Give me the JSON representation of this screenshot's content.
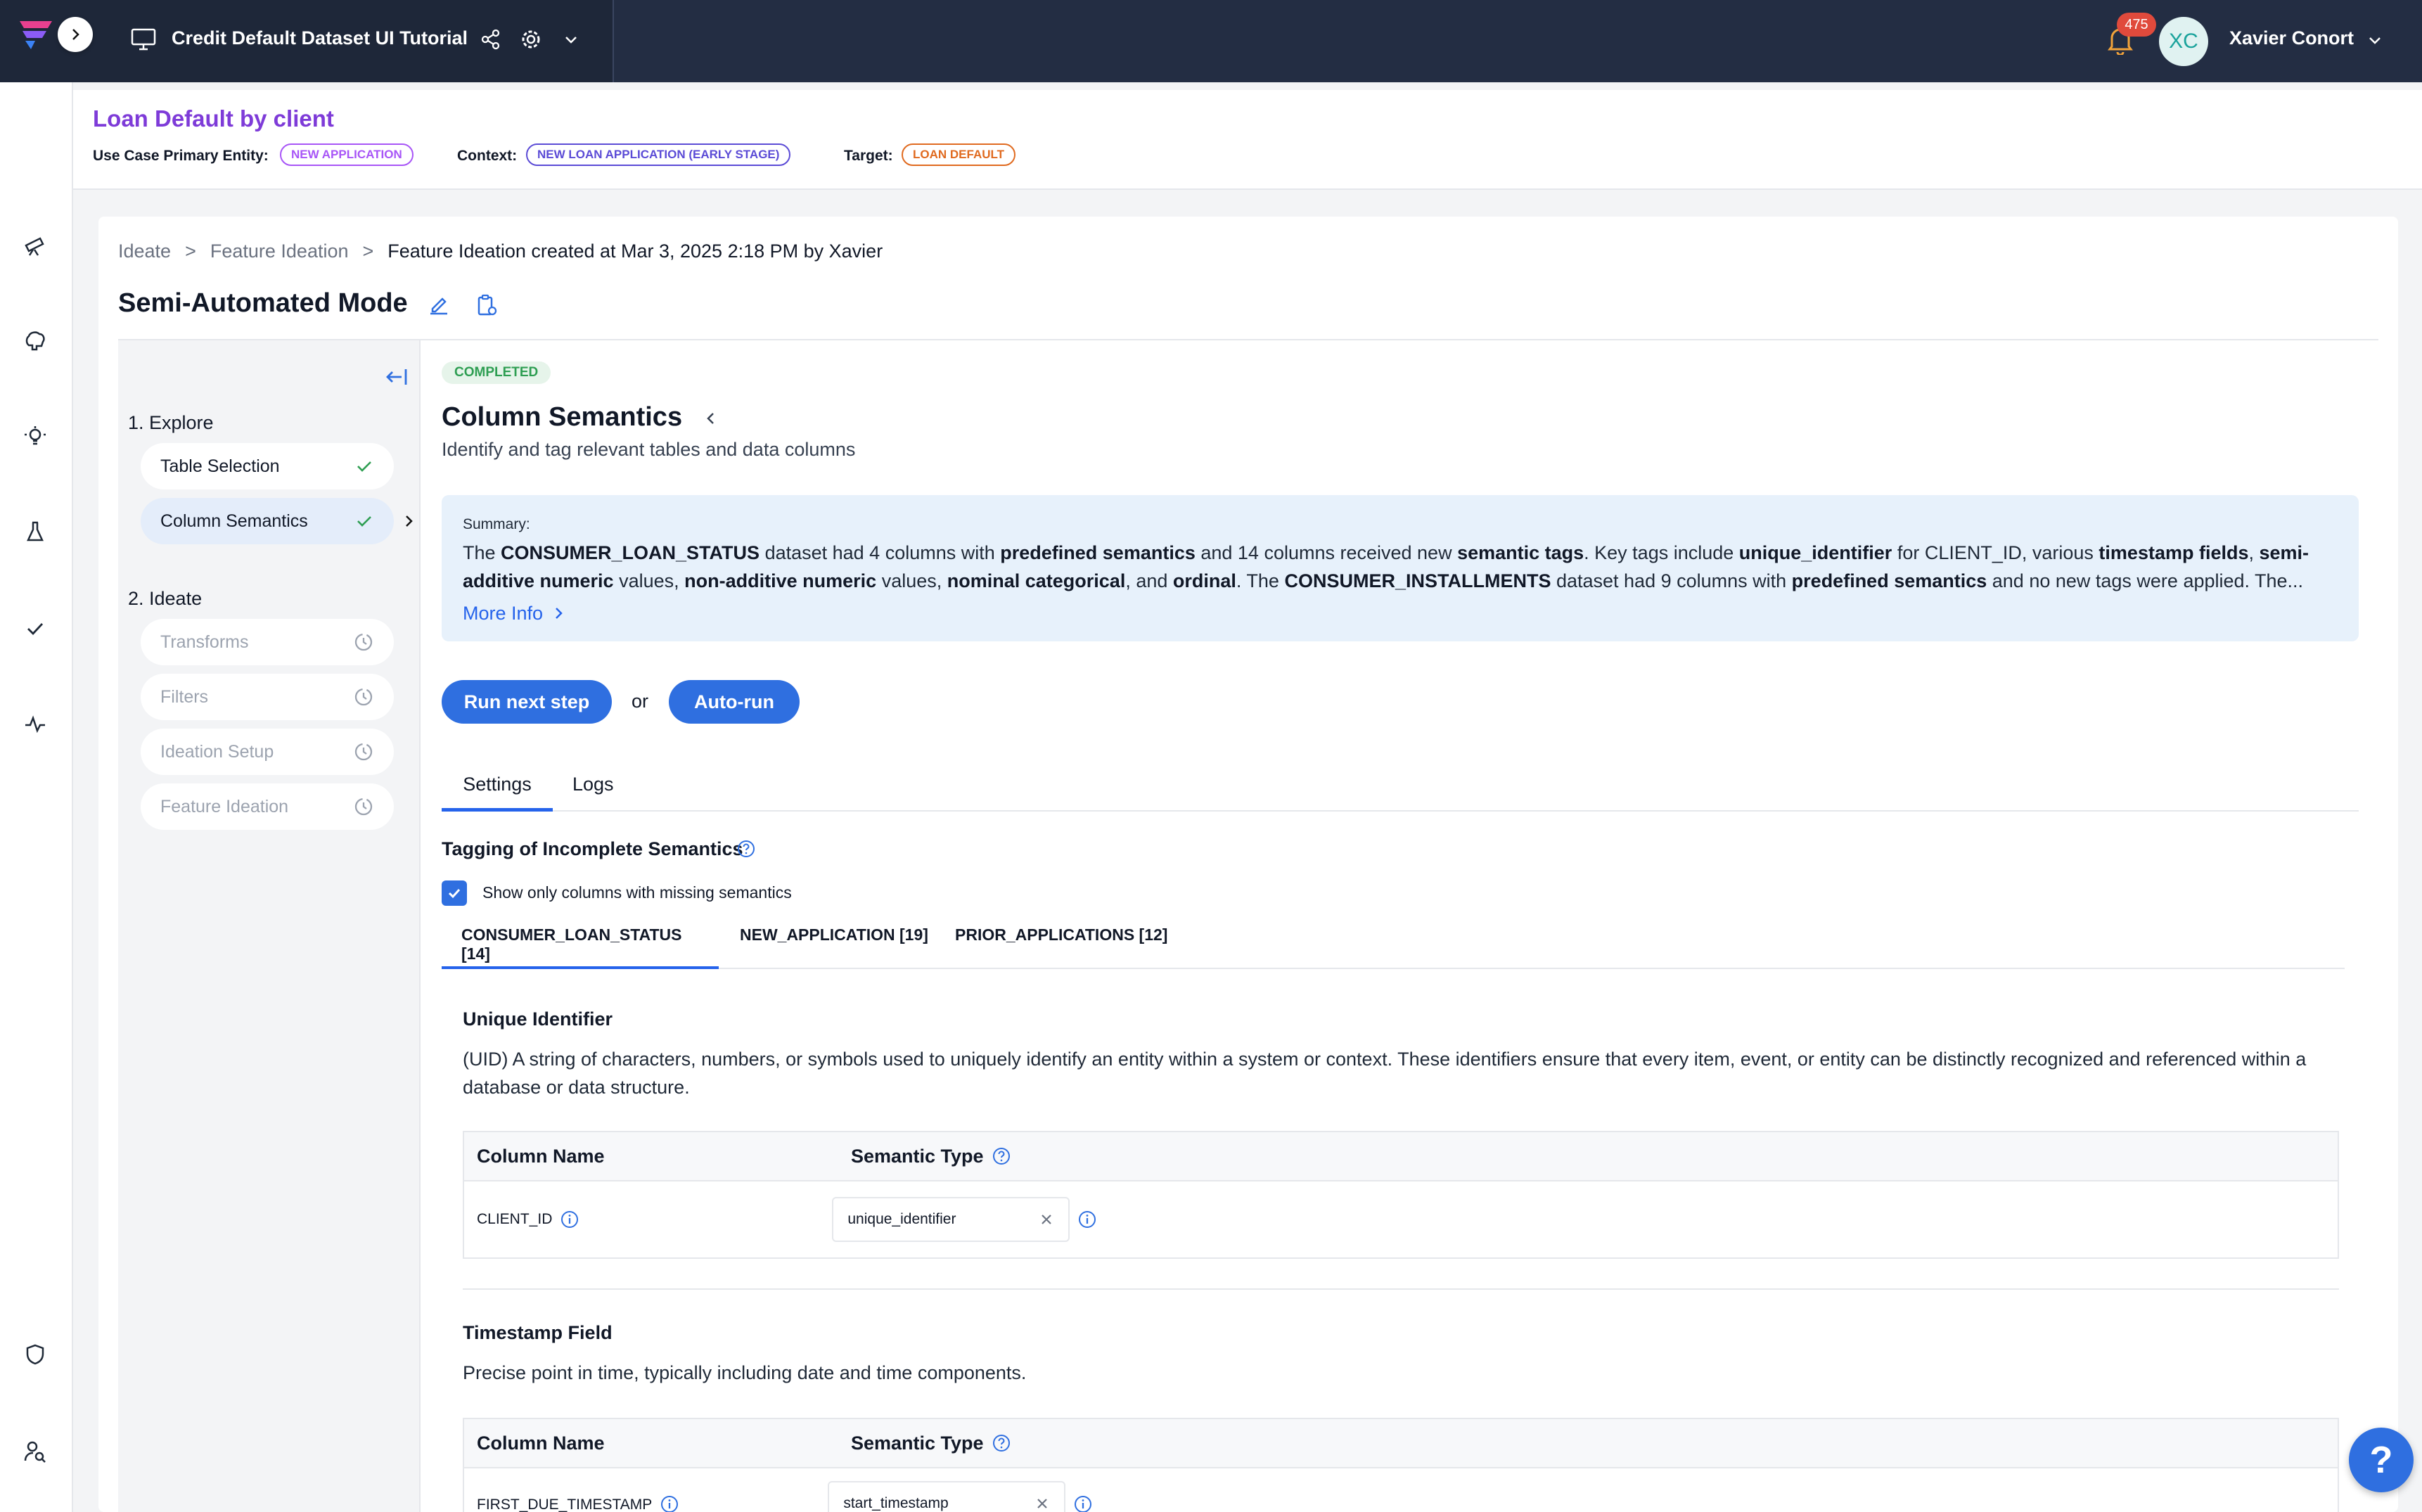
{
  "app": {
    "title": "Credit Default Dataset UI Tutorial",
    "user_name": "Xavier Conort",
    "user_initials": "XC",
    "notifications": "475"
  },
  "use_case": {
    "title": "Loan Default by client",
    "entity_label": "Use Case Primary Entity:",
    "entity_value": "NEW APPLICATION",
    "context_label": "Context:",
    "context_value": "NEW LOAN APPLICATION (EARLY STAGE)",
    "target_label": "Target:",
    "target_value": "LOAN DEFAULT"
  },
  "breadcrumb": [
    "Ideate",
    "Feature Ideation",
    "Feature Ideation created at Mar 3, 2025 2:18 PM by Xavier"
  ],
  "mode_title": "Semi-Automated Mode",
  "steps": {
    "explore_label": "1. Explore",
    "explore": [
      {
        "label": "Table Selection"
      },
      {
        "label": "Column Semantics"
      }
    ],
    "ideate_label": "2. Ideate",
    "ideate": [
      {
        "label": "Transforms"
      },
      {
        "label": "Filters"
      },
      {
        "label": "Ideation Setup"
      },
      {
        "label": "Feature Ideation"
      }
    ]
  },
  "main": {
    "status": "COMPLETED",
    "title": "Column Semantics",
    "subtitle": "Identify and tag relevant tables and data columns",
    "summary_label": "Summary:",
    "summary_parts": [
      "The ",
      "CONSUMER_LOAN_STATUS",
      " dataset had 4 columns with ",
      "predefined semantics",
      " and 14 columns received new ",
      "semantic tags",
      ". Key tags include ",
      "unique_identifier",
      " for CLIENT_ID, various ",
      "timestamp fields",
      ", ",
      "semi-additive numeric",
      " values, ",
      "non-additive numeric",
      " values, ",
      "nominal categorical",
      ", and ",
      "ordinal",
      ". The ",
      "CONSUMER_INSTALLMENTS",
      " dataset had 9 columns with ",
      "predefined semantics",
      " and no new tags were applied. The..."
    ],
    "more_info": "More Info",
    "run_next": "Run next step",
    "or": "or",
    "auto_run": "Auto-run",
    "tabs": [
      "Settings",
      "Logs"
    ],
    "section_title": "Tagging of Incomplete Semantics",
    "checkbox_label": "Show only columns with missing semantics",
    "dataset_tabs": [
      "CONSUMER_LOAN_STATUS [14]",
      "NEW_APPLICATION [19]",
      "PRIOR_APPLICATIONS [12]"
    ],
    "groups": [
      {
        "title": "Unique Identifier",
        "description": "(UID) A string of characters, numbers, or symbols used to uniquely identify an entity within a system or context. These identifiers ensure that every item, event, or entity can be distinctly recognized and referenced within a database or data structure.",
        "col_header": "Column Name",
        "type_header": "Semantic Type",
        "rows": [
          {
            "column": "CLIENT_ID",
            "type": "unique_identifier"
          }
        ]
      },
      {
        "title": "Timestamp Field",
        "description": "Precise point in time, typically including date and time components.",
        "col_header": "Column Name",
        "type_header": "Semantic Type",
        "rows": [
          {
            "column": "FIRST_DUE_TIMESTAMP",
            "type": "start_timestamp"
          }
        ]
      }
    ]
  },
  "colors": {
    "topbar": "#232d43",
    "accent": "#2f6fe0",
    "title_purple": "#7e3bd8",
    "entity_pill": "#a855f7",
    "context_pill": "#5b4bd6",
    "target_pill": "#e06a1f",
    "status_green": "#2e9e52"
  }
}
